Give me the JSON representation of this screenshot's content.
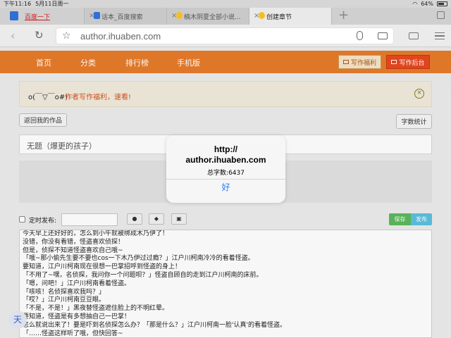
{
  "status_bar": {
    "time": "下午11:16",
    "date": "5月11日周一",
    "wifi": "wifi",
    "battery_percent": "64%"
  },
  "tabs": [
    {
      "label": "百度一下",
      "icon": "baidu-icon",
      "active": false
    },
    {
      "label": "话本_百度搜索",
      "icon": "baidu-icon",
      "active": false
    },
    {
      "label": "楠木阴夏全部小说...",
      "icon": "bulb-icon",
      "active": false
    },
    {
      "label": "创建章节",
      "icon": "bulb-icon",
      "active": true
    }
  ],
  "new_tab_label": "+",
  "url_bar": {
    "url": "author.ihuaben.com"
  },
  "site_nav": {
    "items": [
      "首页",
      "分类",
      "排行榜",
      "手机版"
    ],
    "welfare_button": "写作福利",
    "backend_button": "写作后台"
  },
  "notice": {
    "face": "o(￣▽￣o#)",
    "text": "作者写作福利，速看!",
    "close": "×"
  },
  "buttons": {
    "back_to_works": "返回我的作品",
    "word_count": "字数统计",
    "save": "保存",
    "publish": "发布"
  },
  "title_input": {
    "value": "无题（爆更的孩子）"
  },
  "schedule": {
    "label": "定时发布:"
  },
  "toolbar_icons": [
    "comment-icon",
    "cat-icon",
    "image-icon"
  ],
  "editor_lines": [
    "今天早上还好好的，怎么到小午就被绑成木乃伊了！",
    "没错，你没有看错，怪盗喜欢侦探！",
    "但是，侦探不知道怪盗喜欢自己哦~",
    "「哦~那小偷先生要不要也cos一下木乃伊过过瘾？」江户川柯南冷冷的看着怪盗。",
    "要知道，江户川柯南现在很想一巴掌招呼到怪盗的身上！",
    "「不用了~嘿，名侦探，我问你一个问题呗？」怪盗自顾自的走到江户川柯南的床前。",
    "「嗯，问吧！」江户川柯南看着怪盗。",
    "「咳咳！名侦探喜欢我吗？」",
    "「哎？」江户川柯南豆豆眼。",
    "「不是，不是！」黑夜替怪盗遮住脸上的不明红晕。",
    "要知道，怪盗是有多想抽自己一巴掌！",
    "怎么就说出来了！要是吓到名侦探怎么办？「那是什么？」江户川柯南一脸'认真'的看着怪盗。",
    "「……怪盗这样听了哦，但快回答~"
  ],
  "side_widget": {
    "label": "天"
  },
  "alert": {
    "title_line1": "http://",
    "title_line2": "author.ihuaben.com",
    "message": "总字数:6437",
    "ok": "好"
  }
}
